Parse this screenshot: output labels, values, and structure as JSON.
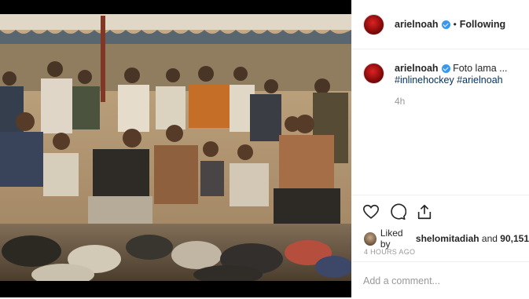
{
  "post": {
    "username": "arielnoah",
    "follow_status": "Following",
    "caption_text": "Foto lama ...",
    "caption_tags": "#inlinehockey #arielnoah",
    "time_relative": "4h",
    "likes_prefix": "Liked by",
    "likes_user": "shelomitadiah",
    "likes_and": "and",
    "likes_count": "90,151",
    "time_full": "4 HOURS AGO",
    "comment_placeholder": "Add a comment..."
  },
  "icons": [
    "heart-icon",
    "comment-icon",
    "share-icon",
    "verified-badge-icon"
  ],
  "colors": {
    "verified": "#3897f0",
    "hashtag": "#003569",
    "muted": "#999999"
  }
}
